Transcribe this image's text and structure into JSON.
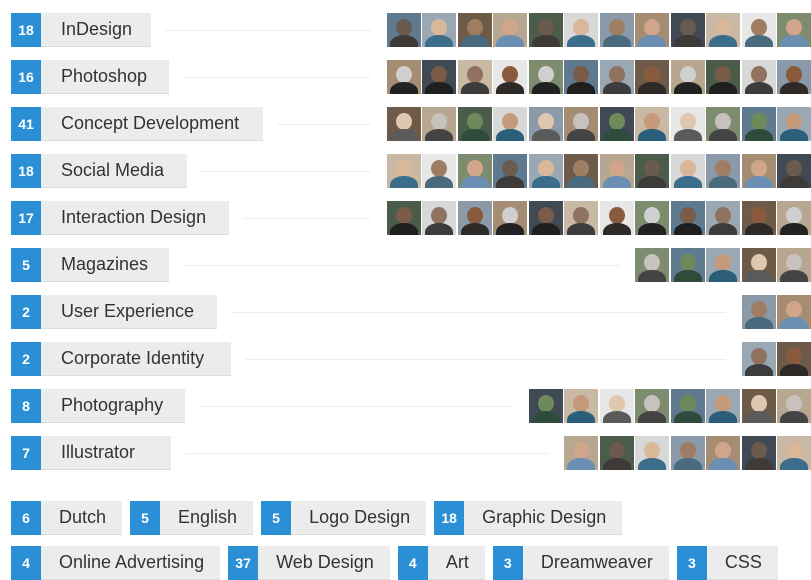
{
  "skills": [
    {
      "count": "18",
      "name": "InDesign"
    },
    {
      "count": "16",
      "name": "Photoshop"
    },
    {
      "count": "41",
      "name": "Concept Development"
    },
    {
      "count": "18",
      "name": "Social Media"
    },
    {
      "count": "17",
      "name": "Interaction Design"
    },
    {
      "count": "5",
      "name": "Magazines"
    },
    {
      "count": "2",
      "name": "User Experience"
    },
    {
      "count": "2",
      "name": "Corporate Identity"
    },
    {
      "count": "8",
      "name": "Photography"
    },
    {
      "count": "7",
      "name": "Illustrator"
    }
  ],
  "tag_rows": [
    [
      {
        "count": "6",
        "name": "Dutch"
      },
      {
        "count": "5",
        "name": "English"
      },
      {
        "count": "5",
        "name": "Logo Design"
      },
      {
        "count": "18",
        "name": "Graphic Design"
      }
    ],
    [
      {
        "count": "4",
        "name": "Online Advertising"
      },
      {
        "count": "37",
        "name": "Web Design"
      },
      {
        "count": "4",
        "name": "Art"
      },
      {
        "count": "3",
        "name": "Dreamweaver"
      },
      {
        "count": "3",
        "name": "CSS"
      }
    ]
  ],
  "colors": {
    "accent": "#2b8fd6",
    "label_bg": "#ececec"
  }
}
